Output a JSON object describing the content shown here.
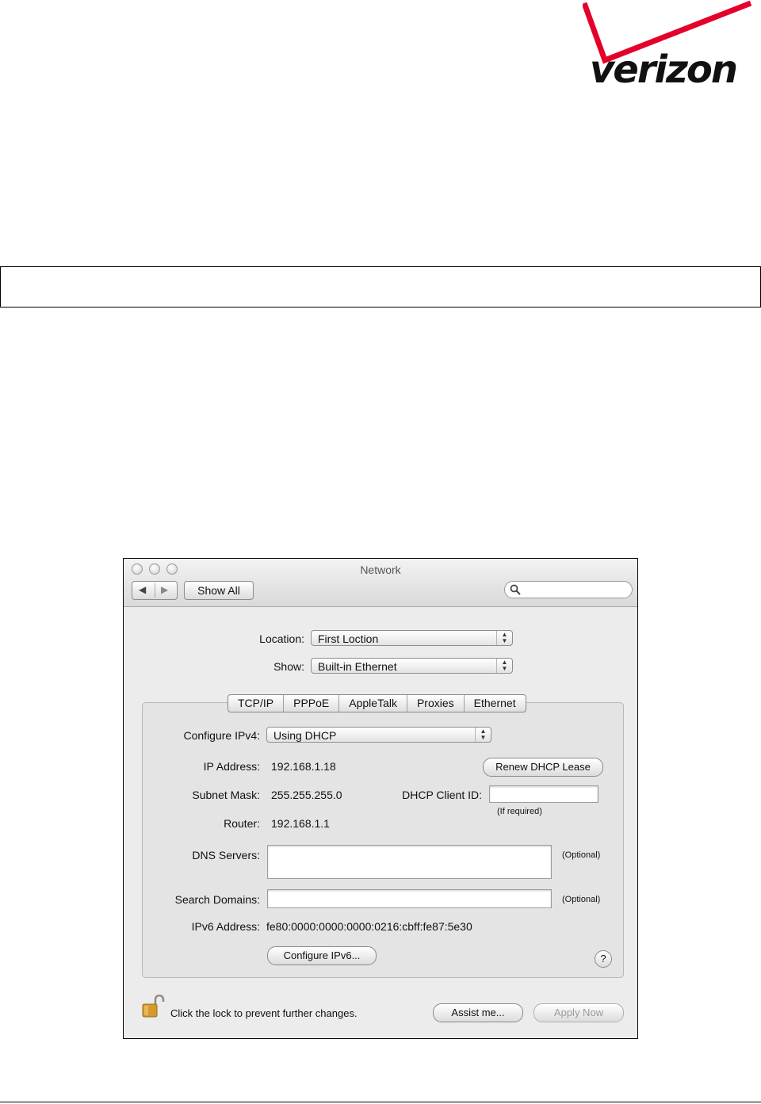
{
  "logo": {
    "text": "verizon"
  },
  "window": {
    "title": "Network",
    "toolbar": {
      "back_label": "◀",
      "forward_label": "▶",
      "show_all_label": "Show All",
      "search_placeholder": ""
    },
    "location": {
      "label": "Location:",
      "value": "First Loction"
    },
    "show": {
      "label": "Show:",
      "value": "Built-in Ethernet"
    },
    "tabs": [
      {
        "label": "TCP/IP"
      },
      {
        "label": "PPPoE"
      },
      {
        "label": "AppleTalk"
      },
      {
        "label": "Proxies"
      },
      {
        "label": "Ethernet"
      }
    ],
    "tcpip": {
      "configure_ipv4": {
        "label": "Configure IPv4:",
        "value": "Using DHCP"
      },
      "ip_address": {
        "label": "IP Address:",
        "value": "192.168.1.18"
      },
      "renew_button": "Renew DHCP Lease",
      "subnet_mask": {
        "label": "Subnet Mask:",
        "value": "255.255.255.0"
      },
      "dhcp_client_id": {
        "label": "DHCP Client ID:",
        "value": "",
        "hint": "(If required)"
      },
      "router": {
        "label": "Router:",
        "value": "192.168.1.1"
      },
      "dns_servers": {
        "label": "DNS Servers:",
        "value": "",
        "hint": "(Optional)"
      },
      "search_domains": {
        "label": "Search Domains:",
        "value": "",
        "hint": "(Optional)"
      },
      "ipv6_address": {
        "label": "IPv6 Address:",
        "value": "fe80:0000:0000:0000:0216:cbff:fe87:5e30"
      },
      "configure_ipv6_button": "Configure IPv6...",
      "help_label": "?"
    },
    "footer": {
      "lock_text": "Click the lock to prevent further changes.",
      "assist_button": "Assist me...",
      "apply_button": "Apply Now"
    }
  },
  "colors": {
    "brand_red": "#e4002b",
    "disabled_text": "#9a9a9a"
  }
}
